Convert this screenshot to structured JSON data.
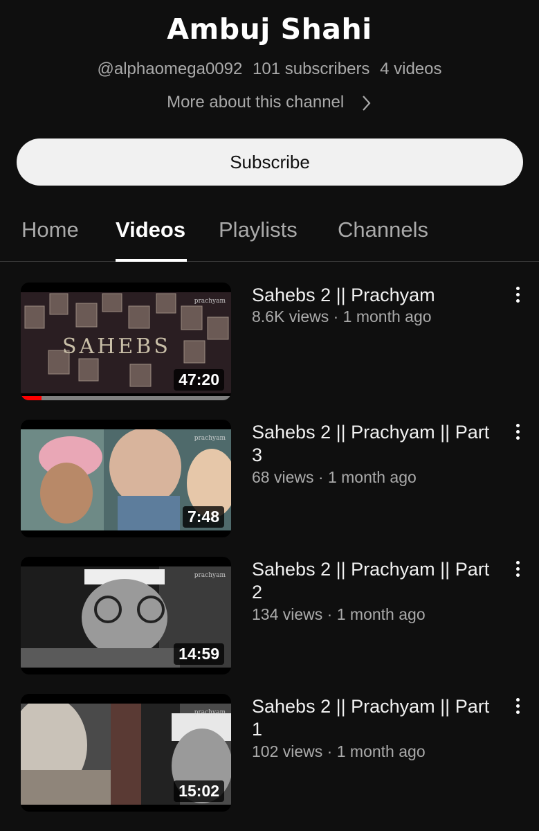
{
  "channel": {
    "name": "Ambuj Shahi",
    "handle": "@alphaomega0092",
    "subscribers": "101 subscribers",
    "video_count": "4 videos",
    "more_about": "More about this channel",
    "subscribe_label": "Subscribe"
  },
  "tabs": [
    {
      "label": "Home",
      "active": false
    },
    {
      "label": "Videos",
      "active": true
    },
    {
      "label": "Playlists",
      "active": false
    },
    {
      "label": "Channels",
      "active": false
    }
  ],
  "watermark": "prachyam",
  "videos": [
    {
      "title": "Sahebs 2 || Prachyam",
      "views": "8.6K views",
      "age": "1 month ago",
      "duration": "47:20",
      "watch_progress": 0.1
    },
    {
      "title": "Sahebs 2 || Prachyam || Part 3",
      "views": "68 views",
      "age": "1 month ago",
      "duration": "7:48"
    },
    {
      "title": "Sahebs 2 || Prachyam || Part 2",
      "views": "134 views",
      "age": "1 month ago",
      "duration": "14:59"
    },
    {
      "title": "Sahebs 2 || Prachyam || Part 1",
      "views": "102 views",
      "age": "1 month ago",
      "duration": "15:02"
    }
  ],
  "colors": {
    "background": "#0f0f0f",
    "secondary_text": "#aaaaaa",
    "progress": "#ff0000"
  }
}
